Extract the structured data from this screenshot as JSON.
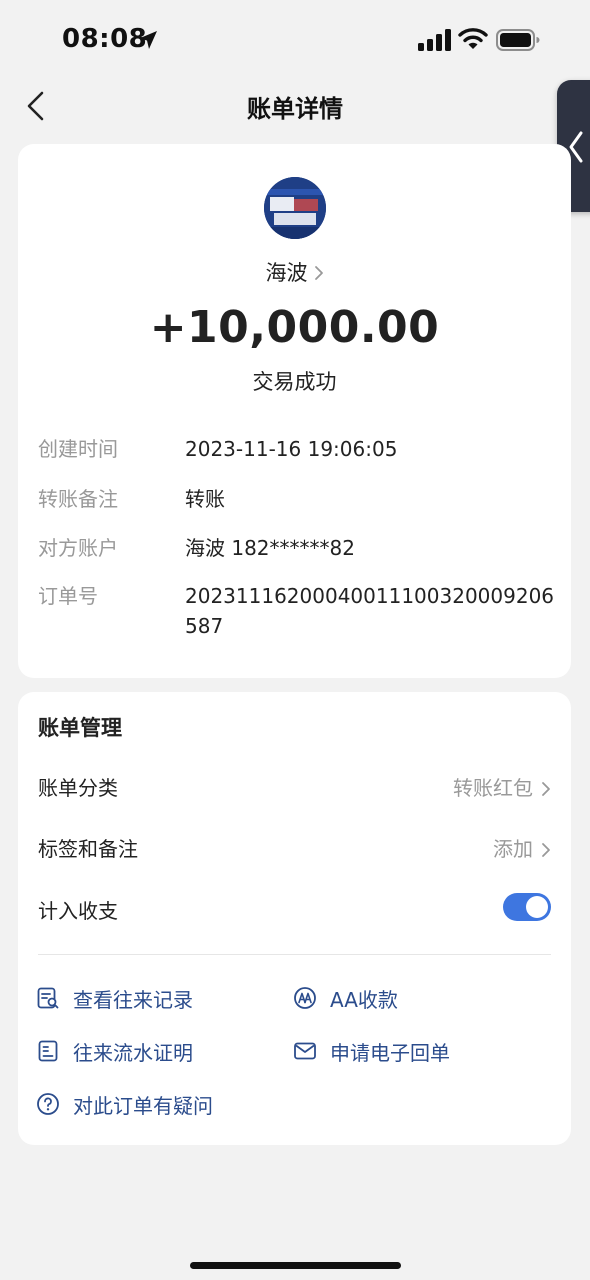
{
  "status_bar": {
    "time": "08:08",
    "icons": [
      "location-arrow-icon",
      "signal-icon",
      "wifi-icon",
      "battery-icon"
    ]
  },
  "header": {
    "title": "账单详情",
    "back_icon": "chevron-left-icon"
  },
  "payee": {
    "avatar_icon": "avatar-image",
    "name": "海波",
    "amount": "+10,000.00",
    "status": "交易成功"
  },
  "details": [
    {
      "label": "创建时间",
      "value": "2023-11-16 19:06:05"
    },
    {
      "label": "转账备注",
      "value": "转账"
    },
    {
      "label": "对方账户",
      "value": "海波 182******82"
    },
    {
      "label": "订单号",
      "value": "20231116200040011100320009206587"
    }
  ],
  "management": {
    "title": "账单管理",
    "category_label": "账单分类",
    "category_value": "转账红包",
    "tags_label": "标签和备注",
    "tags_value": "添加",
    "include_label": "计入收支",
    "include_enabled": true
  },
  "actions": [
    {
      "label": "查看往来记录",
      "icon": "record-search-icon"
    },
    {
      "label": "AA收款",
      "icon": "aa-icon"
    },
    {
      "label": "往来流水证明",
      "icon": "document-icon"
    },
    {
      "label": "申请电子回单",
      "icon": "mail-icon"
    },
    {
      "label": "对此订单有疑问",
      "icon": "question-icon"
    }
  ],
  "colors": {
    "accent": "#3e76e0",
    "link": "#2b4c8c",
    "background": "#f2f2f2",
    "muted": "#999999"
  }
}
